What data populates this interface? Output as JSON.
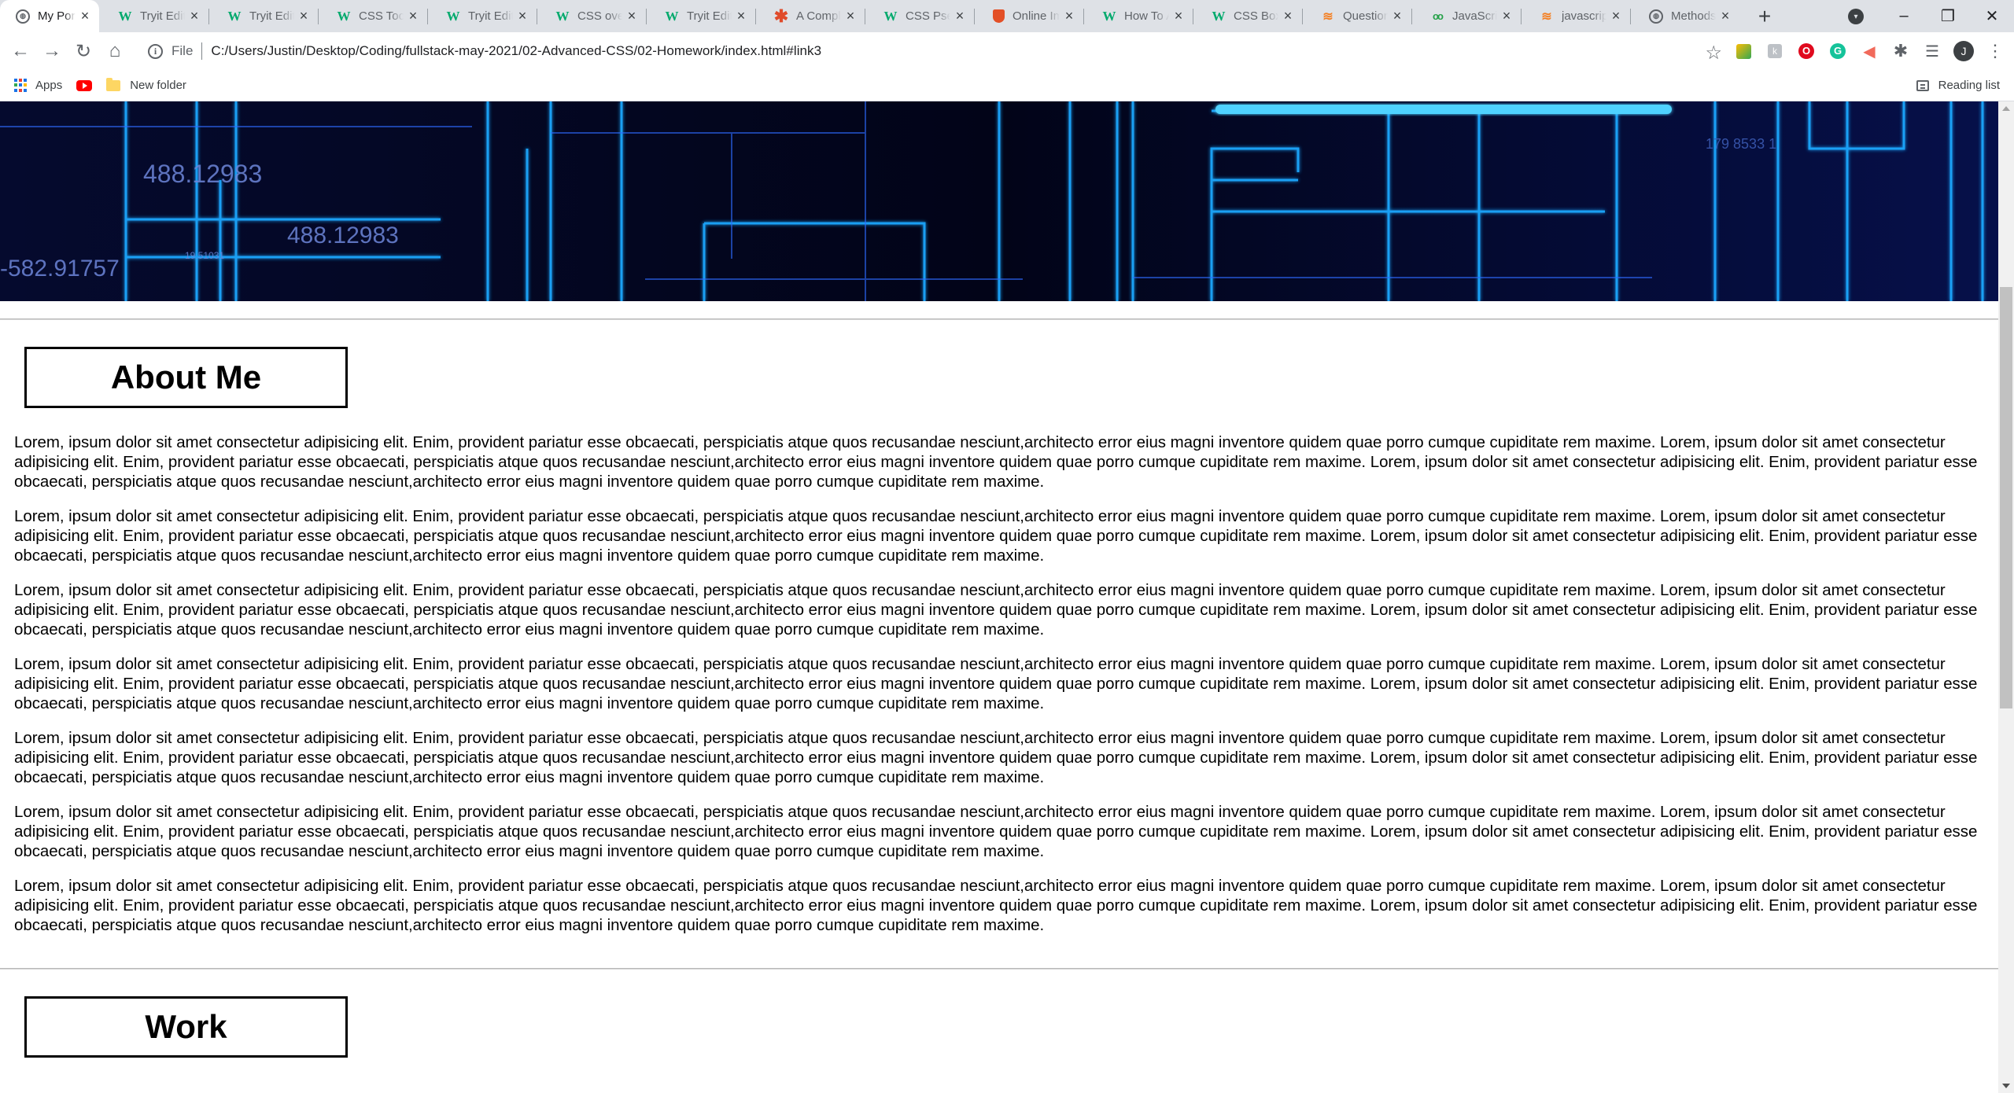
{
  "browser": {
    "tabs": [
      {
        "label": "My Portfolio",
        "icon": "globe-icon",
        "active": true
      },
      {
        "label": "Tryit Editor",
        "icon": "w3schools-icon"
      },
      {
        "label": "Tryit Editor",
        "icon": "w3schools-icon"
      },
      {
        "label": "CSS Tooltip",
        "icon": "w3schools-icon"
      },
      {
        "label": "Tryit Editor",
        "icon": "w3schools-icon"
      },
      {
        "label": "CSS overflow",
        "icon": "w3schools-icon"
      },
      {
        "label": "Tryit Editor",
        "icon": "w3schools-icon"
      },
      {
        "label": "A Complete",
        "icon": "asterisk-icon"
      },
      {
        "label": "CSS Pseudo",
        "icon": "w3schools-icon"
      },
      {
        "label": "Online Image",
        "icon": "shield-icon"
      },
      {
        "label": "How To Add",
        "icon": "w3schools-icon"
      },
      {
        "label": "CSS Box",
        "icon": "w3schools-icon"
      },
      {
        "label": "Question",
        "icon": "stackoverflow-icon"
      },
      {
        "label": "JavaScript",
        "icon": "js-icon"
      },
      {
        "label": "javascript",
        "icon": "stackoverflow-icon"
      },
      {
        "label": "Methods",
        "icon": "globe-icon"
      }
    ],
    "new_tab": "+",
    "window": {
      "minimize": "–",
      "restore": "❐",
      "close": "✕"
    },
    "nav": {
      "back": "←",
      "forward": "→",
      "reload": "↻",
      "home": "⌂"
    },
    "address": {
      "scheme": "File",
      "url": "C:/Users/Justin/Desktop/Coding/fullstack-may-2021/02-Advanced-CSS/02-Homework/index.html#link3"
    },
    "profile_initial": "J",
    "bookmarks": {
      "apps": "Apps",
      "folder": "New folder",
      "reading_list": "Reading list"
    }
  },
  "hero": {
    "numbers": [
      "488.12983",
      "488.12983",
      "-582.91757",
      "179 8533 1",
      "19.51031"
    ]
  },
  "about": {
    "title": "About Me",
    "paragraphs": [
      "Lorem, ipsum dolor sit amet consectetur adipisicing elit. Enim, provident pariatur esse obcaecati, perspiciatis atque quos recusandae nesciunt,architecto error eius magni inventore quidem quae porro cumque cupiditate rem maxime. Lorem, ipsum dolor sit amet consectetur adipisicing elit. Enim, provident pariatur esse obcaecati, perspiciatis atque quos recusandae nesciunt,architecto error eius magni inventore quidem quae porro cumque cupiditate rem maxime. Lorem, ipsum dolor sit amet consectetur adipisicing elit. Enim, provident pariatur esse obcaecati, perspiciatis atque quos recusandae nesciunt,architecto error eius magni inventore quidem quae porro cumque cupiditate rem maxime.",
      "Lorem, ipsum dolor sit amet consectetur adipisicing elit. Enim, provident pariatur esse obcaecati, perspiciatis atque quos recusandae nesciunt,architecto error eius magni inventore quidem quae porro cumque cupiditate rem maxime. Lorem, ipsum dolor sit amet consectetur adipisicing elit. Enim, provident pariatur esse obcaecati, perspiciatis atque quos recusandae nesciunt,architecto error eius magni inventore quidem quae porro cumque cupiditate rem maxime. Lorem, ipsum dolor sit amet consectetur adipisicing elit. Enim, provident pariatur esse obcaecati, perspiciatis atque quos recusandae nesciunt,architecto error eius magni inventore quidem quae porro cumque cupiditate rem maxime.",
      "Lorem, ipsum dolor sit amet consectetur adipisicing elit. Enim, provident pariatur esse obcaecati, perspiciatis atque quos recusandae nesciunt,architecto error eius magni inventore quidem quae porro cumque cupiditate rem maxime. Lorem, ipsum dolor sit amet consectetur adipisicing elit. Enim, provident pariatur esse obcaecati, perspiciatis atque quos recusandae nesciunt,architecto error eius magni inventore quidem quae porro cumque cupiditate rem maxime. Lorem, ipsum dolor sit amet consectetur adipisicing elit. Enim, provident pariatur esse obcaecati, perspiciatis atque quos recusandae nesciunt,architecto error eius magni inventore quidem quae porro cumque cupiditate rem maxime.",
      "Lorem, ipsum dolor sit amet consectetur adipisicing elit. Enim, provident pariatur esse obcaecati, perspiciatis atque quos recusandae nesciunt,architecto error eius magni inventore quidem quae porro cumque cupiditate rem maxime. Lorem, ipsum dolor sit amet consectetur adipisicing elit. Enim, provident pariatur esse obcaecati, perspiciatis atque quos recusandae nesciunt,architecto error eius magni inventore quidem quae porro cumque cupiditate rem maxime. Lorem, ipsum dolor sit amet consectetur adipisicing elit. Enim, provident pariatur esse obcaecati, perspiciatis atque quos recusandae nesciunt,architecto error eius magni inventore quidem quae porro cumque cupiditate rem maxime.",
      "Lorem, ipsum dolor sit amet consectetur adipisicing elit. Enim, provident pariatur esse obcaecati, perspiciatis atque quos recusandae nesciunt,architecto error eius magni inventore quidem quae porro cumque cupiditate rem maxime. Lorem, ipsum dolor sit amet consectetur adipisicing elit. Enim, provident pariatur esse obcaecati, perspiciatis atque quos recusandae nesciunt,architecto error eius magni inventore quidem quae porro cumque cupiditate rem maxime. Lorem, ipsum dolor sit amet consectetur adipisicing elit. Enim, provident pariatur esse obcaecati, perspiciatis atque quos recusandae nesciunt,architecto error eius magni inventore quidem quae porro cumque cupiditate rem maxime.",
      "Lorem, ipsum dolor sit amet consectetur adipisicing elit. Enim, provident pariatur esse obcaecati, perspiciatis atque quos recusandae nesciunt,architecto error eius magni inventore quidem quae porro cumque cupiditate rem maxime. Lorem, ipsum dolor sit amet consectetur adipisicing elit. Enim, provident pariatur esse obcaecati, perspiciatis atque quos recusandae nesciunt,architecto error eius magni inventore quidem quae porro cumque cupiditate rem maxime. Lorem, ipsum dolor sit amet consectetur adipisicing elit. Enim, provident pariatur esse obcaecati, perspiciatis atque quos recusandae nesciunt,architecto error eius magni inventore quidem quae porro cumque cupiditate rem maxime.",
      "Lorem, ipsum dolor sit amet consectetur adipisicing elit. Enim, provident pariatur esse obcaecati, perspiciatis atque quos recusandae nesciunt,architecto error eius magni inventore quidem quae porro cumque cupiditate rem maxime. Lorem, ipsum dolor sit amet consectetur adipisicing elit. Enim, provident pariatur esse obcaecati, perspiciatis atque quos recusandae nesciunt,architecto error eius magni inventore quidem quae porro cumque cupiditate rem maxime. Lorem, ipsum dolor sit amet consectetur adipisicing elit. Enim, provident pariatur esse obcaecati, perspiciatis atque quos recusandae nesciunt,architecto error eius magni inventore quidem quae porro cumque cupiditate rem maxime."
    ]
  },
  "work": {
    "title": "Work"
  },
  "colors": {
    "hero_background": "#03061e",
    "hero_lines": "#1aa8ff",
    "tabstrip": "#dee1e6"
  }
}
